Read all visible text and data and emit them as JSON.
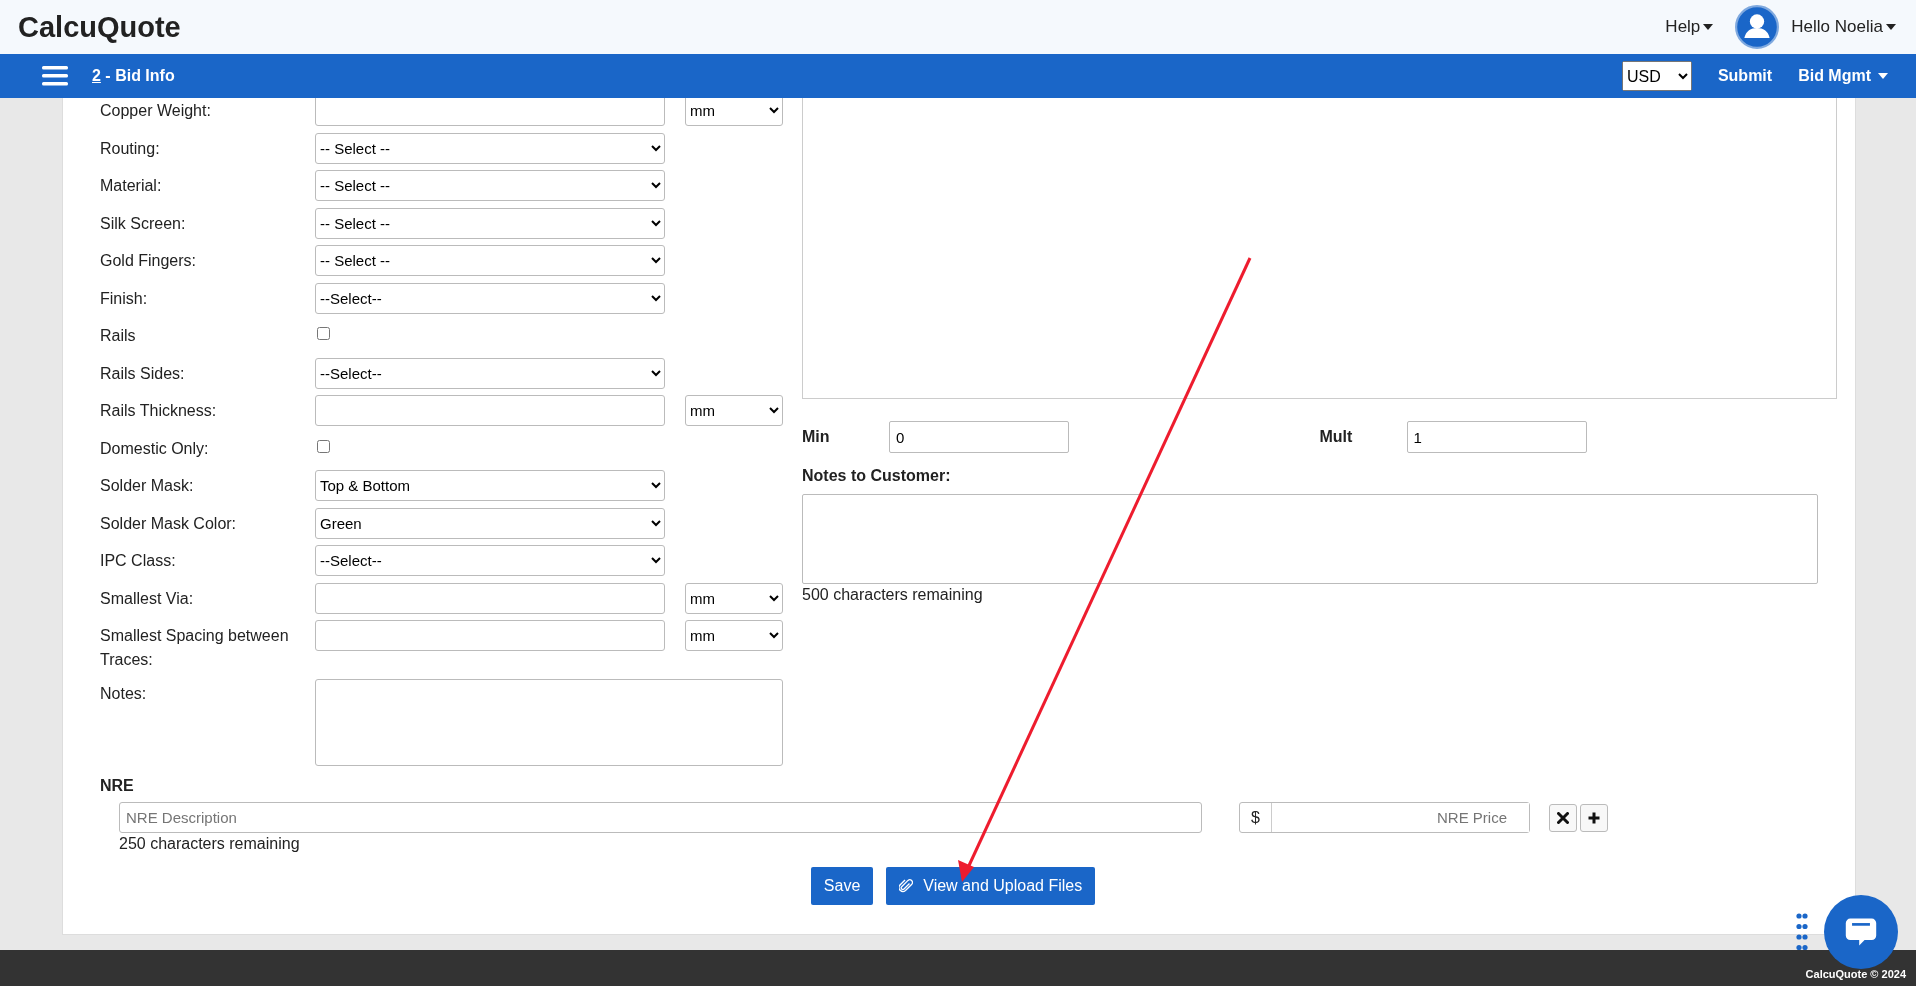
{
  "header": {
    "logo": "CalcuQuote",
    "help": "Help",
    "greeting": "Hello Noelia"
  },
  "nav": {
    "step_number": "2",
    "step_title": " - Bid Info",
    "currency": "USD",
    "submit": "Submit",
    "bid_mgmt": "Bid Mgmt"
  },
  "fields": [
    {
      "label": "Copper Weight:",
      "kind": "text",
      "unit": "mm"
    },
    {
      "label": "Routing:",
      "kind": "select",
      "value": "-- Select --"
    },
    {
      "label": "Material:",
      "kind": "select",
      "value": "-- Select --"
    },
    {
      "label": "Silk Screen:",
      "kind": "select",
      "value": "-- Select --"
    },
    {
      "label": "Gold Fingers:",
      "kind": "select",
      "value": "-- Select --"
    },
    {
      "label": "Finish:",
      "kind": "select",
      "value": "--Select--"
    },
    {
      "label": "Rails",
      "kind": "checkbox",
      "checked": false
    },
    {
      "label": "Rails Sides:",
      "kind": "select",
      "value": "--Select--"
    },
    {
      "label": "Rails Thickness:",
      "kind": "text",
      "unit": "mm"
    },
    {
      "label": "Domestic Only:",
      "kind": "checkbox",
      "checked": false
    },
    {
      "label": "Solder Mask:",
      "kind": "select",
      "value": "Top & Bottom"
    },
    {
      "label": "Solder Mask Color:",
      "kind": "select",
      "value": "Green"
    },
    {
      "label": "IPC Class:",
      "kind": "select",
      "value": "--Select--"
    },
    {
      "label": "Smallest Via:",
      "kind": "text",
      "unit": "mm"
    },
    {
      "label": "Smallest Spacing between Traces:",
      "kind": "text",
      "unit": "mm"
    },
    {
      "label": "Notes:",
      "kind": "textarea"
    }
  ],
  "quantities": [
    {
      "label": "Min",
      "value": "0"
    },
    {
      "label": "Mult",
      "value": "1"
    }
  ],
  "notes_to_customer": {
    "label": "Notes to Customer:",
    "remaining": "500 characters remaining"
  },
  "nre": {
    "title": "NRE",
    "description_placeholder": "NRE Description",
    "currency_symbol": "$",
    "price_placeholder": "NRE Price",
    "remaining": "250 characters remaining"
  },
  "buttons": [
    {
      "label": "Save",
      "kind": "plain"
    },
    {
      "label": "View and Upload Files",
      "kind": "attach"
    }
  ],
  "footer": "CalcuQuote © 2024"
}
